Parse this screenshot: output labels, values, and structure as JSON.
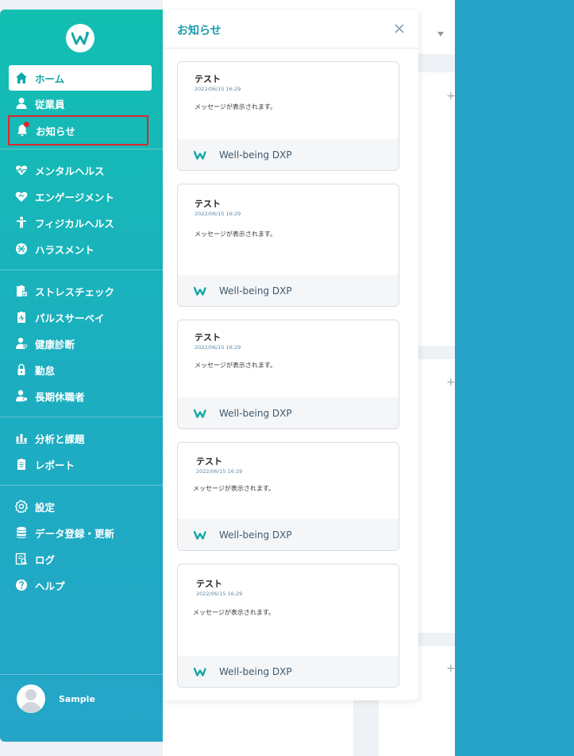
{
  "app": {
    "brand_icon": "wellbeing-logo-icon"
  },
  "sidebar": {
    "items": [
      {
        "label": "ホーム",
        "icon": "home-icon"
      },
      {
        "label": "従業員",
        "icon": "person-icon"
      },
      {
        "label": "お知らせ",
        "icon": "bell-icon"
      },
      {
        "label": "メンタルヘルス",
        "icon": "heart-pulse-icon"
      },
      {
        "label": "エンゲージメント",
        "icon": "heart-handshake-icon"
      },
      {
        "label": "フィジカルヘルス",
        "icon": "figure-icon"
      },
      {
        "label": "ハラスメント",
        "icon": "harassment-icon"
      },
      {
        "label": "ストレスチェック",
        "icon": "clipboard-check-icon"
      },
      {
        "label": "パルスサーベイ",
        "icon": "survey-icon"
      },
      {
        "label": "健康診断",
        "icon": "medical-person-icon"
      },
      {
        "label": "勤怠",
        "icon": "lock-icon"
      },
      {
        "label": "長期休職者",
        "icon": "person-leave-icon"
      },
      {
        "label": "分析と課題",
        "icon": "bar-chart-icon"
      },
      {
        "label": "レポート",
        "icon": "report-icon"
      },
      {
        "label": "設定",
        "icon": "gear-icon"
      },
      {
        "label": "データ登録・更新",
        "icon": "database-icon"
      },
      {
        "label": "ログ",
        "icon": "log-icon"
      },
      {
        "label": "ヘルプ",
        "icon": "help-icon"
      }
    ],
    "user": {
      "name": "Sample"
    }
  },
  "panel": {
    "title": "お知らせ",
    "cards": [
      {
        "title": "テスト",
        "date": "2022/06/15 16:29",
        "message": "メッセージが表示されます。",
        "source": "Well-being DXP"
      },
      {
        "title": "テスト",
        "date": "2022/06/15 16:29",
        "message": "メッセージが表示されます。",
        "source": "Well-being DXP"
      },
      {
        "title": "テスト",
        "date": "2022/06/15 16:29",
        "message": "メッセージが表示されます。",
        "source": "Well-being DXP"
      },
      {
        "title": "テスト",
        "date": "2022/06/15 16:29",
        "message": "メッセージが表示されます。",
        "source": "Well-being DXP"
      },
      {
        "title": "テスト",
        "date": "2022/06/15 16:29",
        "message": "メッセージが表示されます。",
        "source": "Well-being DXP"
      }
    ]
  },
  "colors": {
    "accent": "#12bfb1",
    "sidebar_end": "#24a5c8",
    "title": "#1a9cac",
    "highlight": "#e0252e"
  }
}
